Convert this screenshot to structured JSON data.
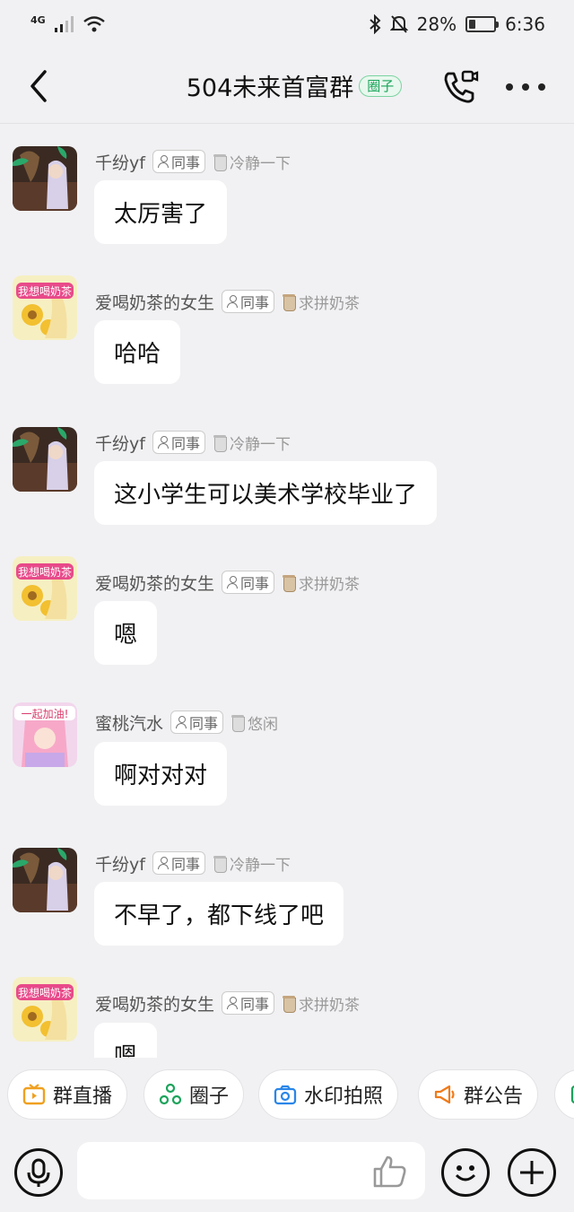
{
  "status_bar": {
    "network": "4G",
    "battery": "28%",
    "battery_level": 0.28,
    "time": "6:36"
  },
  "header": {
    "title": "504未来首富群",
    "tag": "圈子"
  },
  "messages": [
    {
      "sender": "千纷yf",
      "role": "同事",
      "status": "冷静一下",
      "text": "太厉害了"
    },
    {
      "sender": "爱喝奶茶的女生",
      "role": "同事",
      "status": "求拼奶茶",
      "text": "哈哈"
    },
    {
      "sender": "千纷yf",
      "role": "同事",
      "status": "冷静一下",
      "text": "这小学生可以美术学校毕业了"
    },
    {
      "sender": "爱喝奶茶的女生",
      "role": "同事",
      "status": "求拼奶茶",
      "text": "嗯"
    },
    {
      "sender": "蜜桃汽水",
      "role": "同事",
      "status": "悠闲",
      "text": "啊对对对"
    },
    {
      "sender": "千纷yf",
      "role": "同事",
      "status": "冷静一下",
      "text": "不早了，都下线了吧"
    },
    {
      "sender": "爱喝奶茶的女生",
      "role": "同事",
      "status": "求拼奶茶",
      "text": "嗯"
    }
  ],
  "avatar_texts": {
    "milk_tea": "我想喝奶茶",
    "peach": "一起加油!"
  },
  "quick_actions": [
    {
      "label": "群直播",
      "icon": "live-tv-icon",
      "color": "#f0a020"
    },
    {
      "label": "圈子",
      "icon": "circle-group-icon",
      "color": "#1aa35a"
    },
    {
      "label": "水印拍照",
      "icon": "camera-icon",
      "color": "#2a86e8"
    },
    {
      "label": "群公告",
      "icon": "megaphone-icon",
      "color": "#f07a1a"
    }
  ],
  "input": {
    "placeholder": ""
  },
  "colors": {
    "background": "#f1f1f3",
    "bubble": "#ffffff",
    "tag_green": "#1aa35a"
  }
}
